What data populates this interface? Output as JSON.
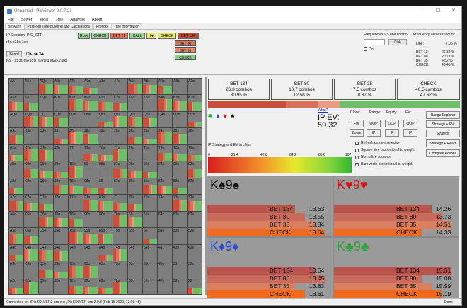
{
  "window": {
    "title": "Unnamed - PioViewer 2.0.7.21",
    "controls": [
      "—",
      "☐",
      "✕"
    ]
  },
  "menu": [
    "File",
    "Solver",
    "Tools",
    "Tree",
    "Analysis",
    "About"
  ],
  "tabs": [
    "Browser",
    "PostFlop Tree Building and Calculations",
    "Preflop",
    "Tree information"
  ],
  "left_info": {
    "ip_decision": "IP Decision:  PIO_CFR",
    "board_code": "r3c:b21c:7c:c",
    "board_button": "Board",
    "board_cards": "Q♠ 7♦ 3♣",
    "pot": "Pot : 21 21 65 (107) Starting Stacks:400"
  },
  "action_path": [
    "Root",
    "CHECK",
    "BET 21",
    "CALL",
    "7♦",
    "CHECK",
    "BET 134"
  ],
  "line_options": [
    "BET 80",
    "BET 35",
    "CHECK"
  ],
  "freq_panel": {
    "vs_label": "Frequencies VS one combo:",
    "pick": "Pick",
    "on": "On",
    "runouts_label": "Frequency across runouts:",
    "line": "Line:",
    "line_value": "7.06 %",
    "rows": [
      {
        "a": "BET 134",
        "v": "26.32 %"
      },
      {
        "a": "BET 80",
        "v": "20.71 %"
      },
      {
        "a": "BET 35",
        "v": "4.52 %"
      },
      {
        "a": "CHECK",
        "v": "48.45 %"
      }
    ]
  },
  "actions": [
    {
      "name": "BET 134",
      "combos": "26.3 combos",
      "pct": "30.95 %",
      "color": "#c74f3c"
    },
    {
      "name": "BET 80",
      "combos": "10.7 combos",
      "pct": "12.56 %",
      "color": "#d9705a"
    },
    {
      "name": "BET 35",
      "combos": "7.5 combos",
      "pct": "8.87 %",
      "color": "#ea9a80"
    },
    {
      "name": "CHECK",
      "combos": "40.5 combos",
      "pct": "47.62 %",
      "color": "#6fbf6a"
    }
  ],
  "mid": {
    "suits": "♣ ♦ ♥ ♠",
    "what": "What?",
    "ip_ev_label": "IP EV:",
    "ip_ev": "59.32",
    "clone": "Clone:",
    "range": "Range:",
    "equity": "Equity:",
    "ev": "EV:",
    "strategy_label": "IP Strategy and EV in chips",
    "scale": [
      "0",
      "21.4",
      "42.8",
      "64.2",
      "85.6",
      "107"
    ]
  },
  "small_buttons": [
    [
      "Full",
      "OOP",
      "OOP",
      "OOP"
    ],
    [
      "Zoom",
      "IP",
      "IP",
      "IP"
    ]
  ],
  "checkboxes": [
    {
      "label": "Refresh on new selection",
      "checked": true
    },
    {
      "label": "Square size proportional to weight",
      "checked": true
    },
    {
      "label": "Normalize squares",
      "checked": true
    },
    {
      "label": "Bars width proportional to weight",
      "checked": false
    }
  ],
  "right_buttons": [
    "Range Explorer",
    "Strategy + EV",
    "Strategy",
    "Strategy + React",
    "Compare Actions"
  ],
  "grid": [
    "AA",
    "AKs",
    "AQs",
    "AJs",
    "ATs",
    "A9s",
    "A8s",
    "A7s",
    "A6s",
    "A5s",
    "A4s",
    "A3s",
    "A2s",
    "AKo",
    "KK",
    "KQs",
    "KJs",
    "KTs",
    "K9s",
    "K8s",
    "K7s",
    "K6s",
    "K5s",
    "K4s",
    "K3s",
    "K2s",
    "AQo",
    "KQo",
    "QQ",
    "QJs",
    "QTs",
    "Q9s",
    "Q8s",
    "Q7s",
    "Q6s",
    "Q5s",
    "Q4s",
    "Q3s",
    "Q2s",
    "AJo",
    "KJo",
    "QJo",
    "JJ",
    "JTs",
    "J9s",
    "J8s",
    "J7s",
    "J6s",
    "J5s",
    "J4s",
    "J3s",
    "J2s",
    "ATo",
    "KTo",
    "QTo",
    "JTo",
    "TT",
    "T9s",
    "T8s",
    "T7s",
    "T6s",
    "T5s",
    "T4s",
    "T3s",
    "T2s",
    "A9o",
    "K9o",
    "Q9o",
    "J9o",
    "T9o",
    "99",
    "98s",
    "97s",
    "96s",
    "95s",
    "94s",
    "93s",
    "92s",
    "A8o",
    "K8o",
    "Q8o",
    "J8o",
    "T8o",
    "98o",
    "88",
    "87s",
    "86s",
    "85s",
    "84s",
    "83s",
    "82s",
    "A7o",
    "K7o",
    "Q7o",
    "J7o",
    "T7o",
    "97o",
    "87o",
    "77",
    "76s",
    "75s",
    "74s",
    "73s",
    "72s",
    "A6o",
    "K6o",
    "Q6o",
    "J6o",
    "T6o",
    "96o",
    "86o",
    "76o",
    "66",
    "65s",
    "64s",
    "63s",
    "62s",
    "A5o",
    "K5o",
    "Q5o",
    "J5o",
    "T5o",
    "95o",
    "85o",
    "75o",
    "65o",
    "55",
    "54s",
    "53s",
    "52s",
    "A4o",
    "K4o",
    "Q4o",
    "J4o",
    "T4o",
    "94o",
    "84o",
    "74o",
    "64o",
    "54o",
    "44",
    "43s",
    "42s",
    "A3o",
    "K3o",
    "Q3o",
    "J3o",
    "T3o",
    "93o",
    "83o",
    "73o",
    "63o",
    "53o",
    "43o",
    "33",
    "32s",
    "A2o",
    "K2o",
    "Q2o",
    "J2o",
    "T2o",
    "92o",
    "82o",
    "72o",
    "62o",
    "52o",
    "42o",
    "32o",
    "22"
  ],
  "hands": [
    {
      "card": "K♠9♠",
      "color": "#111",
      "rows": [
        {
          "a": "BET 134",
          "v": "13.63"
        },
        {
          "a": "BET 80",
          "v": "13.55"
        },
        {
          "a": "BET 35",
          "v": "13.84"
        },
        {
          "a": "CHECK",
          "v": "13.64"
        }
      ]
    },
    {
      "card": "K♥9♥",
      "color": "#d11",
      "rows": [
        {
          "a": "BET 134",
          "v": "14.26"
        },
        {
          "a": "BET 80",
          "v": "13.73"
        },
        {
          "a": "BET 35",
          "v": "14.51"
        },
        {
          "a": "CHECK",
          "v": "14.33"
        }
      ]
    },
    {
      "card": "K♦9♦",
      "color": "#2a4fd8",
      "rows": [
        {
          "a": "BET 134",
          "v": "13.64"
        },
        {
          "a": "BET 80",
          "v": "13.45"
        },
        {
          "a": "BET 35",
          "v": "13.83"
        },
        {
          "a": "CHECK",
          "v": "13.61"
        }
      ]
    },
    {
      "card": "K♣9♣",
      "color": "#2aa33a",
      "rows": [
        {
          "a": "BET 134",
          "v": "15.51"
        },
        {
          "a": "BET 80",
          "v": "15.08"
        },
        {
          "a": "BET 35",
          "v": "15.59"
        },
        {
          "a": "CHECK",
          "v": "15.19"
        }
      ]
    }
  ],
  "status": {
    "text": "Connected to: ./PioSOLVER2-pro.exe, PioSOLVER-pro 2.0.8 (Feb 16 2022, 13:03:45)",
    "right": "Done"
  }
}
